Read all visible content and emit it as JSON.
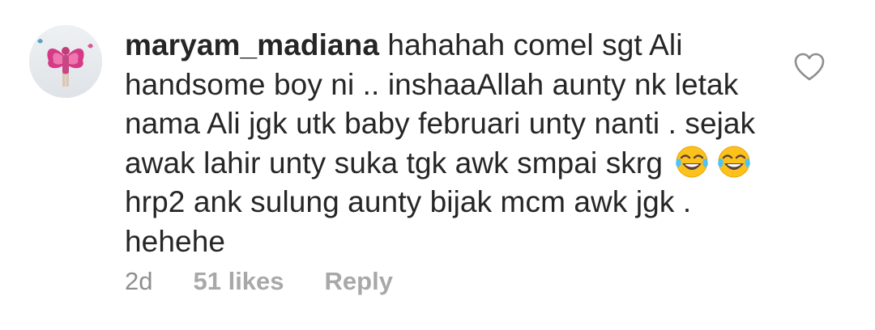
{
  "comment": {
    "username": "maryam_madiana",
    "text_before_emoji": "hahahah comel sgt Ali handsome boy ni .. inshaaAllah aunty nk letak nama Ali jgk utk baby februari unty nanti . sejak awak lahir unty suka tgk awk smpai skrg",
    "emojis": [
      "😂",
      "😂"
    ],
    "text_after_emoji": "hrp2 ank sulung aunty bijak mcm awk jgk . hehehe",
    "time": "2d",
    "likes": "51 likes",
    "reply_label": "Reply"
  },
  "icons": {
    "like": "heart-outline-icon",
    "emoji": "face-with-tears-of-joy"
  },
  "colors": {
    "text": "#262626",
    "meta": "#a8a8a8",
    "heart_stroke": "#8e8e8e"
  }
}
